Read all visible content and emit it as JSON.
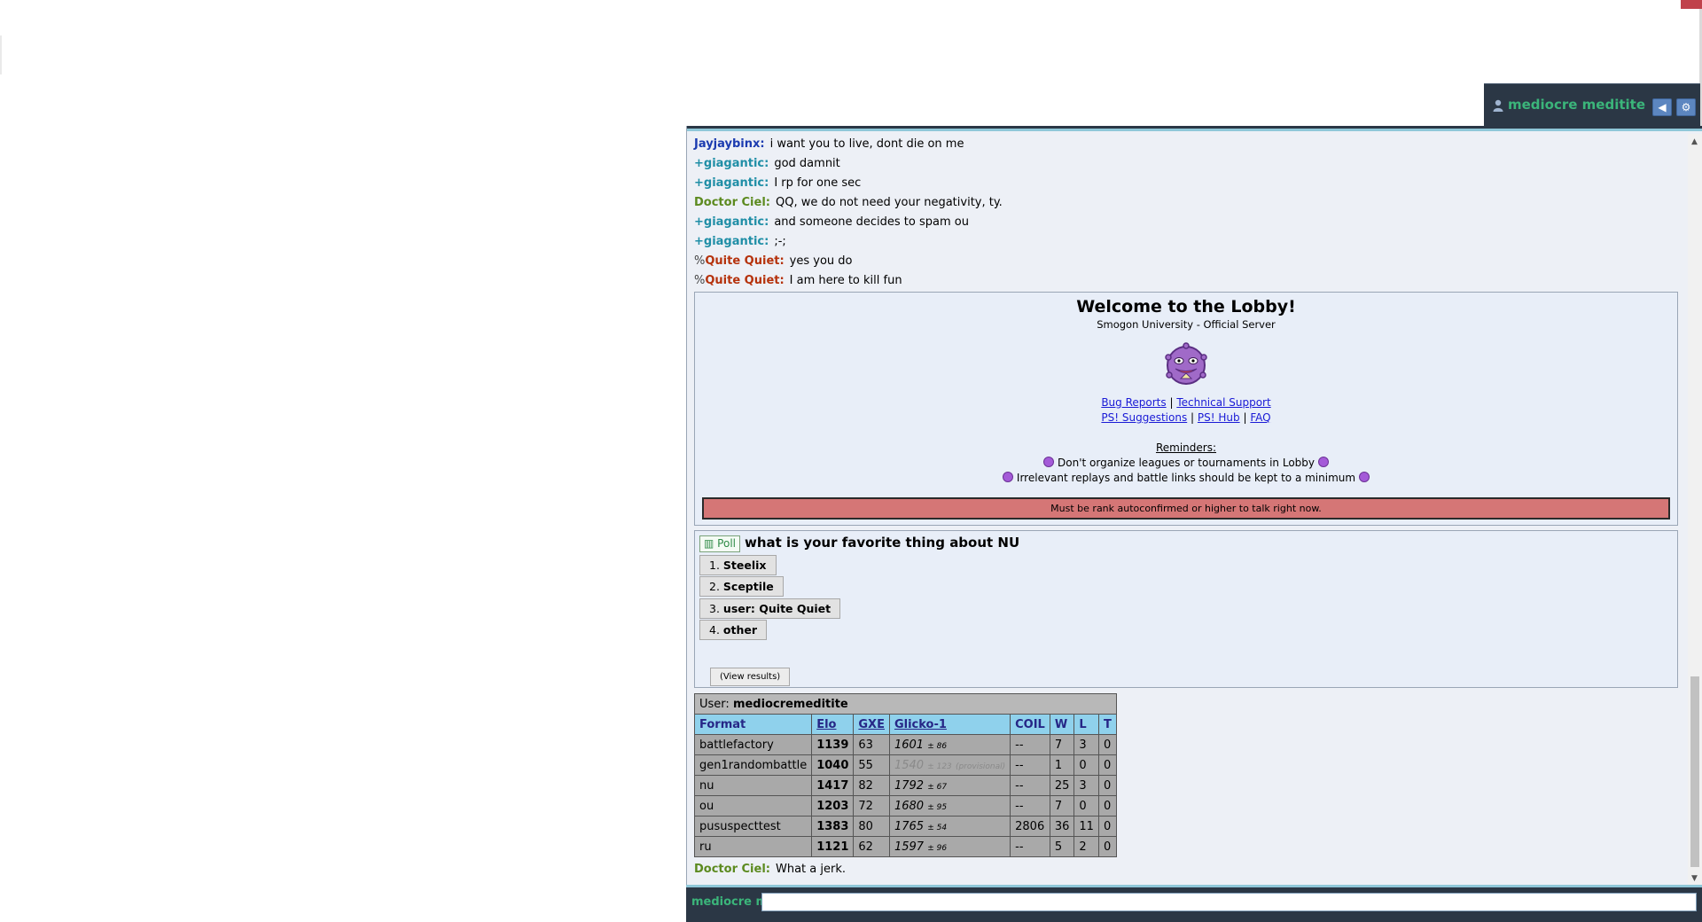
{
  "user_bar": {
    "username": "mediocre meditite"
  },
  "chat": {
    "messages_before": [
      {
        "rank": "",
        "name": "Jayjaybinx:",
        "name_color": "#1b3bb0",
        "text": "i want you to live, dont die on me"
      },
      {
        "rank": "",
        "name": "+giagantic:",
        "name_color": "#1f8ea6",
        "text": "god damnit"
      },
      {
        "rank": "",
        "name": "+giagantic:",
        "name_color": "#1f8ea6",
        "text": "I rp for one sec"
      },
      {
        "rank": "",
        "name": "Doctor Ciel:",
        "name_color": "#5c8a1f",
        "text": "QQ, we do not need your negativity, ty."
      },
      {
        "rank": "",
        "name": "+giagantic:",
        "name_color": "#1f8ea6",
        "text": "and someone decides to spam ou"
      },
      {
        "rank": "",
        "name": "+giagantic:",
        "name_color": "#1f8ea6",
        "text": ";-;"
      },
      {
        "rank": "%",
        "name": "Quite Quiet:",
        "name_color": "#b5320c",
        "text": "yes you do"
      },
      {
        "rank": "%",
        "name": "Quite Quiet:",
        "name_color": "#b5320c",
        "text": "I am here to kill fun"
      }
    ],
    "last_message": {
      "name": "Doctor Ciel:",
      "name_color": "#5c8a1f",
      "text": "What a jerk."
    }
  },
  "lobby": {
    "title": "Welcome to the Lobby!",
    "subtitle": "Smogon University - Official Server",
    "links": {
      "bug_reports": "Bug Reports",
      "technical_support": "Technical Support",
      "suggestions": "PS! Suggestions",
      "hub": "PS! Hub",
      "faq": "FAQ",
      "separator": "|"
    },
    "reminders_title": "Reminders:",
    "reminders": [
      "Don't organize leagues or tournaments in Lobby",
      "Irrelevant replays and battle links should be kept to a minimum"
    ],
    "alert": "Must be rank autoconfirmed or higher to talk right now."
  },
  "poll": {
    "tag": "Poll",
    "question": "what is your favorite thing about NU",
    "options": [
      {
        "num": "1.",
        "label": "Steelix"
      },
      {
        "num": "2.",
        "label": "Sceptile"
      },
      {
        "num": "3.",
        "label": "user: Quite Quiet"
      },
      {
        "num": "4.",
        "label": "other"
      }
    ],
    "view_results": "(View results)"
  },
  "ladder": {
    "user_label": "User:",
    "user": "mediocremeditite",
    "headers": [
      "Format",
      "Elo",
      "GXE",
      "Glicko-1",
      "COIL",
      "W",
      "L",
      "T"
    ],
    "rows": [
      {
        "format": "battlefactory",
        "elo": "1139",
        "gxe": "63",
        "glicko": "1601",
        "dev": "± 86",
        "prov": "",
        "coil": "--",
        "w": "7",
        "l": "3",
        "t": "0"
      },
      {
        "format": "gen1randombattle",
        "elo": "1040",
        "gxe": "55",
        "glicko": "1540",
        "dev": "± 123",
        "prov": "(provisional)",
        "coil": "--",
        "w": "1",
        "l": "0",
        "t": "0"
      },
      {
        "format": "nu",
        "elo": "1417",
        "gxe": "82",
        "glicko": "1792",
        "dev": "± 67",
        "prov": "",
        "coil": "--",
        "w": "25",
        "l": "3",
        "t": "0"
      },
      {
        "format": "ou",
        "elo": "1203",
        "gxe": "72",
        "glicko": "1680",
        "dev": "± 95",
        "prov": "",
        "coil": "--",
        "w": "7",
        "l": "0",
        "t": "0"
      },
      {
        "format": "pususpecttest",
        "elo": "1383",
        "gxe": "80",
        "glicko": "1765",
        "dev": "± 54",
        "prov": "",
        "coil": "2806",
        "w": "36",
        "l": "11",
        "t": "0"
      },
      {
        "format": "ru",
        "elo": "1121",
        "gxe": "62",
        "glicko": "1597",
        "dev": "± 96",
        "prov": "",
        "coil": "--",
        "w": "5",
        "l": "2",
        "t": "0"
      }
    ]
  },
  "input": {
    "label": "mediocre m",
    "value": ""
  }
}
